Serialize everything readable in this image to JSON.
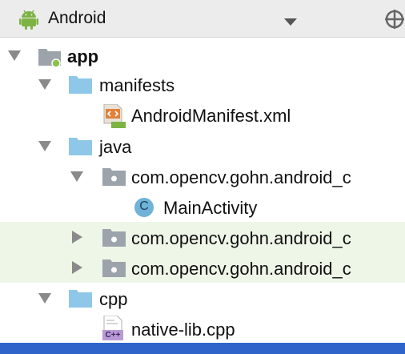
{
  "header": {
    "title": "Android",
    "view_icon": "android-icon",
    "dropdown_icon": "caret-down-icon",
    "locate_icon": "crosshair-icon"
  },
  "tree": [
    {
      "label": "app",
      "icon": "module-icon",
      "expanded": true,
      "bold": true
    },
    {
      "label": "manifests",
      "icon": "folder-icon",
      "expanded": true
    },
    {
      "label": "AndroidManifest.xml",
      "icon": "manifest-file-icon"
    },
    {
      "label": "java",
      "icon": "folder-icon",
      "expanded": true
    },
    {
      "label": "com.opencv.gohn.android_c",
      "icon": "package-icon",
      "expanded": true
    },
    {
      "label": "MainActivity",
      "icon": "class-icon",
      "icon_letter": "C"
    },
    {
      "label": "com.opencv.gohn.android_c",
      "icon": "package-icon",
      "expanded": false,
      "test_source": true
    },
    {
      "label": "com.opencv.gohn.android_c",
      "icon": "package-icon",
      "expanded": false,
      "test_source": true
    },
    {
      "label": "cpp",
      "icon": "folder-icon",
      "expanded": true
    },
    {
      "label": "native-lib.cpp",
      "icon": "cpp-file-icon",
      "icon_text": "C++"
    }
  ],
  "colors": {
    "folder": "#8ec7e8",
    "selection": "#2f65ca",
    "test_row": "#eef6e8",
    "android_green": "#7cb342"
  }
}
